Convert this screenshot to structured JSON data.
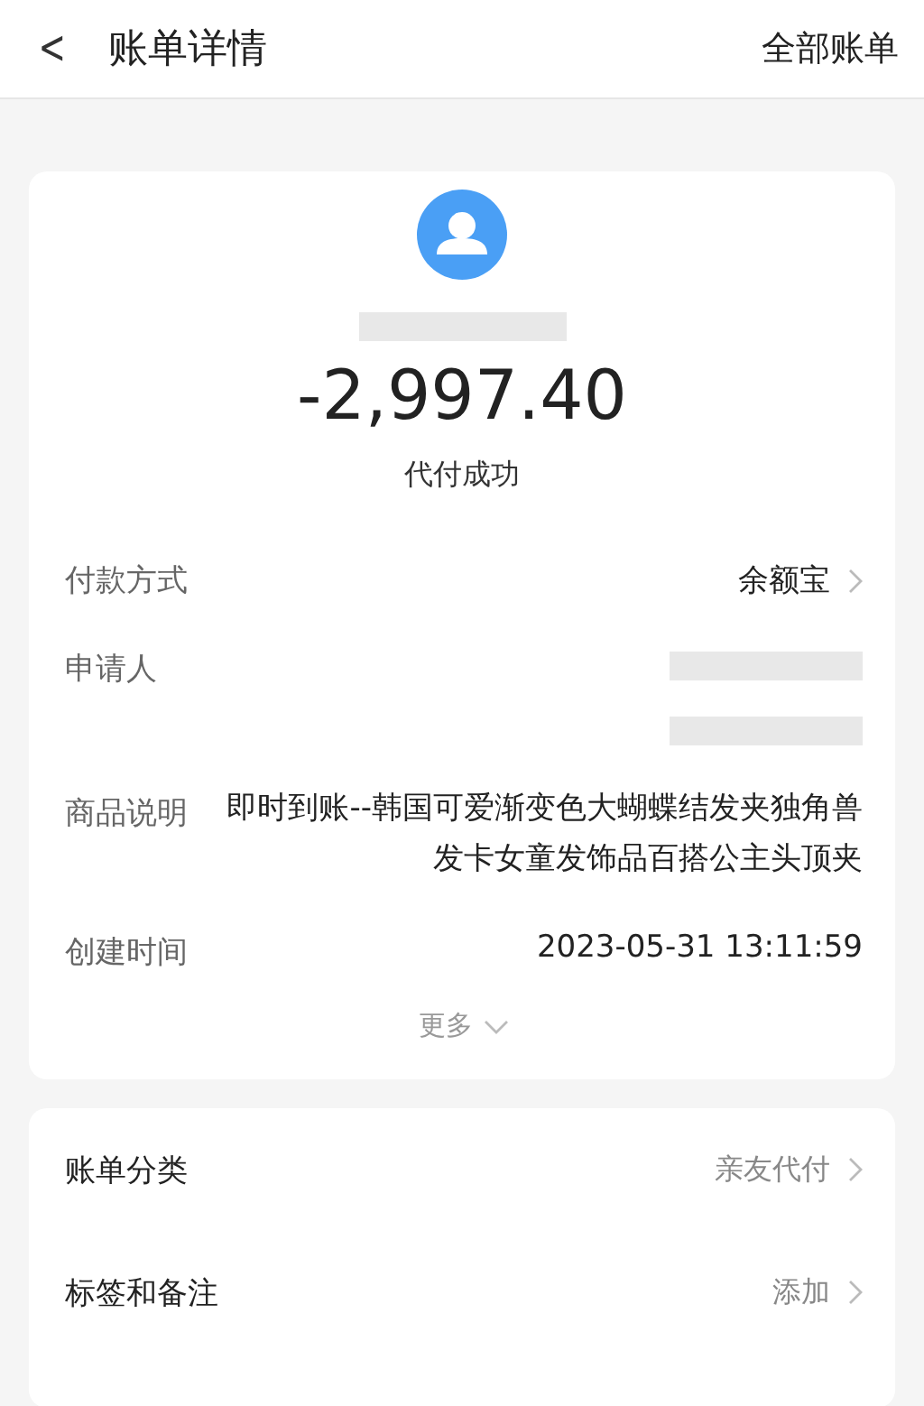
{
  "header": {
    "back": "<",
    "title": "账单详情",
    "action": "全部账单"
  },
  "summary": {
    "payee_redacted": true,
    "amount": "-2,997.40",
    "status": "代付成功"
  },
  "details": [
    {
      "kind": "link",
      "label": "付款方式",
      "value": "余额宝"
    },
    {
      "kind": "redacted",
      "label": "申请人"
    },
    {
      "kind": "text",
      "label": "商品说明",
      "value": "即时到账--韩国可爱渐变色大蝴蝶结发夹独角兽发卡女童发饰品百搭公主头顶夹"
    },
    {
      "kind": "text",
      "label": "创建时间",
      "value": "2023-05-31 13:11:59"
    }
  ],
  "more": {
    "label": "更多",
    "expanded": false
  },
  "actions": [
    {
      "label": "账单分类",
      "value": "亲友代付"
    },
    {
      "label": "标签和备注",
      "value": "添加"
    }
  ]
}
